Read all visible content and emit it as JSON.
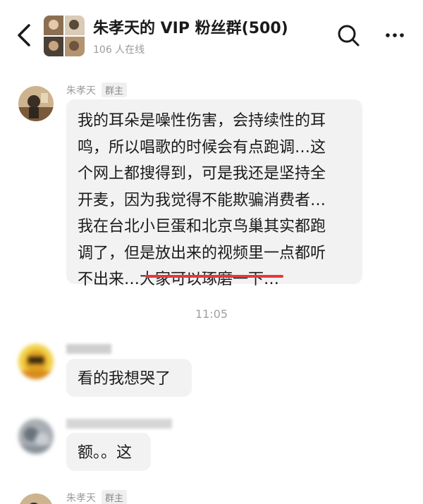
{
  "header": {
    "title": "朱孝天的 VIP 粉丝群(500)",
    "online": "106 人在线",
    "icons": {
      "back": "back-arrow-icon",
      "search": "search-icon",
      "more": "more-icon"
    }
  },
  "messages": [
    {
      "sender": "朱孝天",
      "role": "群主",
      "lines": [
        "我的耳朵是噪性伤害，会持续性的耳",
        "鸣，所以唱歌的时候会有点跑调…这",
        "个网上都搜得到，可是我还是坚持全",
        "开麦，因为我觉得不能欺骗消费者…",
        "我在台北小巨蛋和北京鸟巢其实都跑",
        "调了，但是放出来的视频里一点都听",
        "不出来…大家可以琢磨一下…"
      ]
    },
    {
      "text": "看的我想哭了"
    },
    {
      "text": "额。。这"
    },
    {
      "sender": "朱孝天",
      "role": "群主"
    }
  ],
  "timestamp": "11:05",
  "colors": {
    "accent_underline": "#e4393c",
    "bubble": "#f2f2f2",
    "meta": "#9a9a9a"
  }
}
